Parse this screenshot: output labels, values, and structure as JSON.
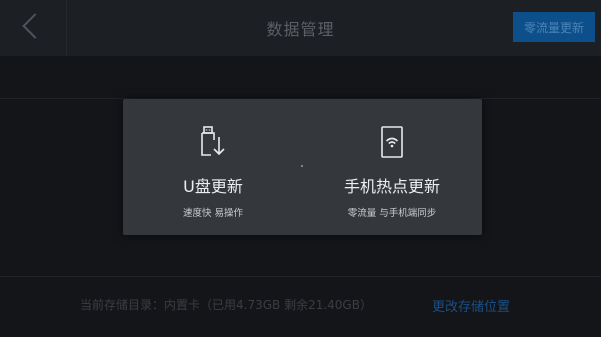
{
  "header": {
    "title": "数据管理",
    "zero_traffic_update_label": "零流量更新"
  },
  "storage": {
    "info": "当前存储目录：内置卡（已用4.73GB 剩余21.40GB）",
    "change_label": "更改存储位置"
  },
  "dialog": {
    "options": [
      {
        "label": "U盘更新",
        "sub": "速度快 易操作",
        "icon": "usb-download-icon"
      },
      {
        "label": "手机热点更新",
        "sub": "零流量 与手机端同步",
        "icon": "phone-wifi-icon"
      }
    ]
  },
  "colors": {
    "accent": "#0d4f8a",
    "link": "#1b4f84",
    "dialog_bg": "#34373c",
    "page_bg": "#131519"
  }
}
